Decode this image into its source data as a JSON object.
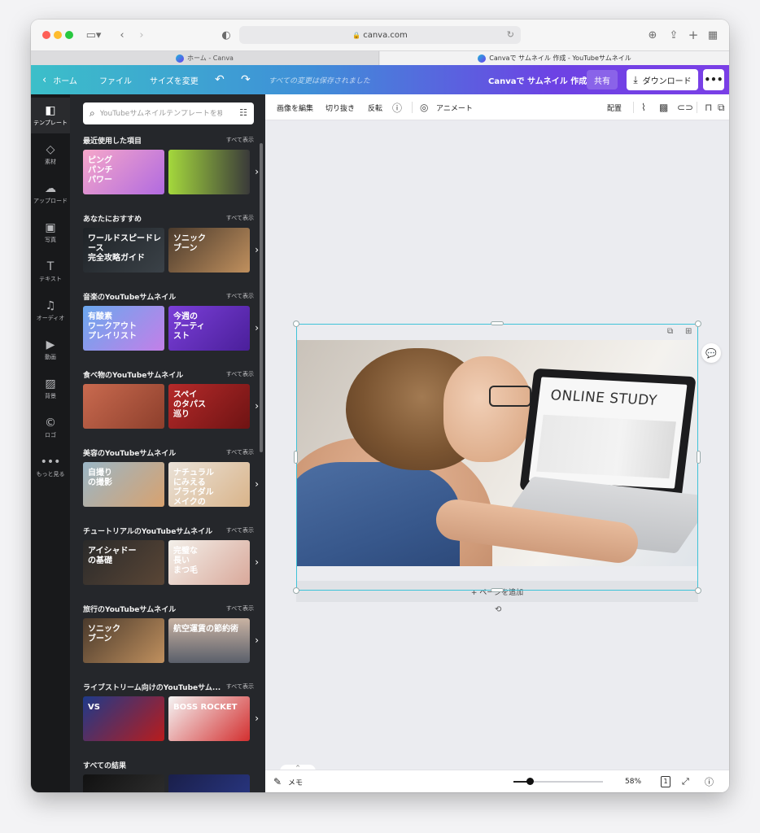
{
  "browser": {
    "url": "canva.com",
    "tabs": [
      {
        "label": "ホーム - Canva",
        "active": false
      },
      {
        "label": "Canvaで サムネイル 作成 - YouTubeサムネイル",
        "active": true
      }
    ]
  },
  "header": {
    "home_label": "ホーム",
    "file_label": "ファイル",
    "resize_label": "サイズを変更",
    "saved_text": "すべての変更は保存されました",
    "doc_title": "Canvaで サムネイル 作成",
    "share_label": "共有",
    "download_label": "ダウンロード",
    "more_label": "•••"
  },
  "rail": {
    "items": [
      {
        "label": "テンプレート",
        "icon": "template-icon",
        "glyph": "◧"
      },
      {
        "label": "素材",
        "icon": "elements-icon",
        "glyph": "◇"
      },
      {
        "label": "アップロード",
        "icon": "upload-icon",
        "glyph": "☁"
      },
      {
        "label": "写真",
        "icon": "photo-icon",
        "glyph": "▣"
      },
      {
        "label": "テキスト",
        "icon": "text-icon",
        "glyph": "T"
      },
      {
        "label": "オーディオ",
        "icon": "audio-icon",
        "glyph": "♫"
      },
      {
        "label": "動画",
        "icon": "video-icon",
        "glyph": "▶"
      },
      {
        "label": "背景",
        "icon": "background-icon",
        "glyph": "▨"
      },
      {
        "label": "ロゴ",
        "icon": "logo-icon",
        "glyph": "©"
      },
      {
        "label": "もっと見る",
        "icon": "more-icon",
        "glyph": "•••"
      }
    ]
  },
  "panel": {
    "search_placeholder": "YouTubeサムネイルテンプレートを検",
    "see_all": "すべて表示",
    "sections": [
      {
        "title": "最近使用した項目",
        "thumbs": [
          {
            "text": "ピング\nパンチ\nパワー",
            "bg": "linear-gradient(135deg,#f6a7c9,#b16ae0)"
          },
          {
            "text": "",
            "bg": "linear-gradient(90deg,#a4d83c,#3a3a3a)"
          }
        ]
      },
      {
        "title": "あなたにおすすめ",
        "thumbs": [
          {
            "text": "ワールドスピードレース\n完全攻略ガイド",
            "bg": "linear-gradient(135deg,#1e2226,#3b4248)"
          },
          {
            "text": "ソニック\nブーン",
            "bg": "linear-gradient(135deg,#4a3a2c,#c0905e)"
          }
        ]
      },
      {
        "title": "音楽のYouTubeサムネイル",
        "thumbs": [
          {
            "text": "有酸素\nワークアウト\nプレイリスト",
            "bg": "linear-gradient(135deg,#6aa8ee,#c37fe8)"
          },
          {
            "text": "今週の\nアーティ\nスト",
            "bg": "linear-gradient(135deg,#7b3fd8,#4a1f9a)"
          }
        ]
      },
      {
        "title": "食べ物のYouTubeサムネイル",
        "thumbs": [
          {
            "text": "",
            "bg": "linear-gradient(135deg,#c96a4f,#8d3f2c)"
          },
          {
            "text": "スペイ\nのタパス\n巡り",
            "bg": "linear-gradient(135deg,#b62a2a,#6e1313)"
          }
        ]
      },
      {
        "title": "美容のYouTubeサムネイル",
        "thumbs": [
          {
            "text": "自撮り\nの撮影",
            "bg": "linear-gradient(135deg,#9ab6c6,#d8a26f)"
          },
          {
            "text": "ナチュラル\nにみえる\nブライダル\nメイクの\nやり方",
            "bg": "linear-gradient(135deg,#eae2d8,#d9b48a)"
          }
        ]
      },
      {
        "title": "チュートリアルのYouTubeサムネイル",
        "thumbs": [
          {
            "text": "アイシャドー\nの基礎",
            "bg": "linear-gradient(135deg,#2a2a2a,#5a4636)"
          },
          {
            "text": "完璧な\n長い\nまつ毛",
            "bg": "linear-gradient(135deg,#f3f0ea,#d9a89a)"
          }
        ]
      },
      {
        "title": "旅行のYouTubeサムネイル",
        "thumbs": [
          {
            "text": "ソニック\nブーン",
            "bg": "linear-gradient(135deg,#4a3a2c,#c0905e)"
          },
          {
            "text": "航空運賃の節約術",
            "bg": "linear-gradient(180deg,#c9b3a3,#5a5f6a)"
          }
        ]
      },
      {
        "title": "ライブストリーム向けのYouTubeサム...",
        "thumbs": [
          {
            "text": "VS",
            "bg": "linear-gradient(135deg,#1e3a8a,#b91c1c)"
          },
          {
            "text": "BOSS ROCKET",
            "bg": "linear-gradient(135deg,#f5f5f5,#d32f2f)"
          }
        ]
      },
      {
        "title": "すべての結果",
        "thumbs": [
          {
            "text": "",
            "bg": "linear-gradient(135deg,#111,#333)"
          },
          {
            "text": "",
            "bg": "linear-gradient(135deg,#1a1f4a,#2b3a8a)"
          }
        ]
      }
    ]
  },
  "editor_toolbar": {
    "edit_image": "画像を編集",
    "crop": "切り抜き",
    "flip": "反転",
    "animate": "アニメート",
    "position": "配置"
  },
  "canvas": {
    "screen_text": "ONLINE STUDY",
    "add_page": "+ ページを追加"
  },
  "bottom_bar": {
    "notes": "メモ",
    "zoom": "58%",
    "page_count": "1",
    "zoom_fraction": 0.18
  },
  "colors": {
    "selection": "#3fc3d8",
    "panel_bg": "#25272b",
    "rail_bg": "#18191b"
  }
}
